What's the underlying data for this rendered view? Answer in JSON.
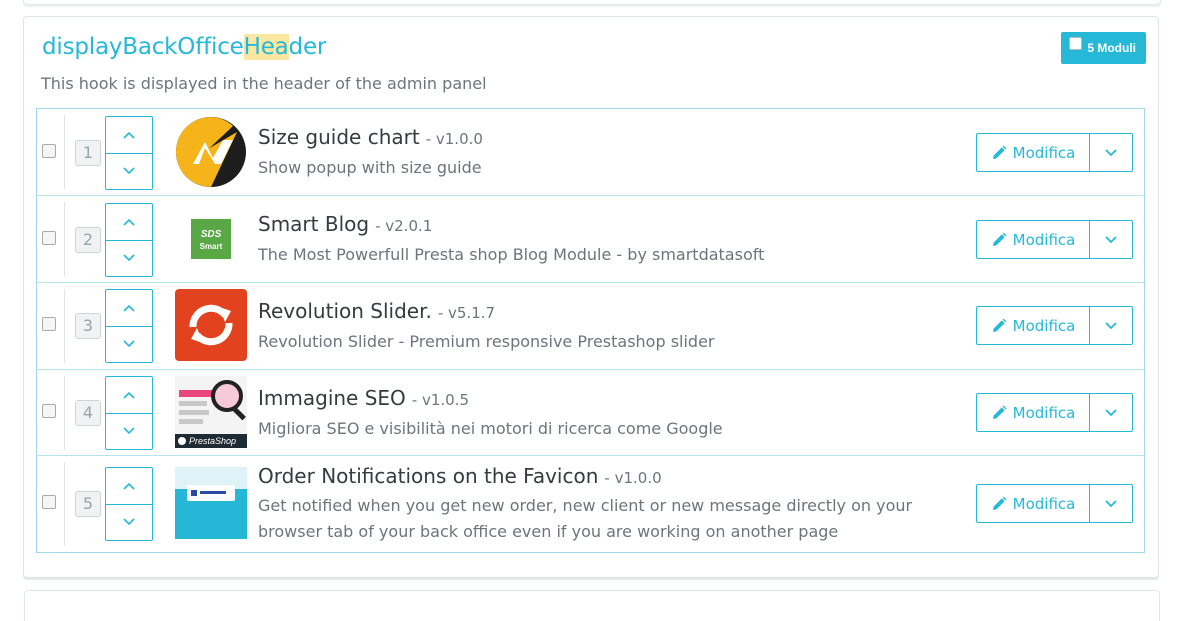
{
  "hook": {
    "title_before": "displayBackOffice",
    "title_highlight": "Hea",
    "title_after": "der",
    "description": "This hook is displayed in the header of the admin panel",
    "badge_label": "5 Moduli"
  },
  "edit_label": "Modifica",
  "modules": [
    {
      "position": "1",
      "name": "Size guide chart",
      "version": "- v1.0.0",
      "description": "Show popup with size guide",
      "logo": "size-guide-logo"
    },
    {
      "position": "2",
      "name": "Smart Blog",
      "version": "- v2.0.1",
      "description": "The Most Powerfull Presta shop Blog Module - by smartdatasoft",
      "logo": "smart-blog-logo",
      "logo_text_top": "SDS",
      "logo_text_bottom": "Smart"
    },
    {
      "position": "3",
      "name": "Revolution Slider.",
      "version": "- v5.1.7",
      "description": "Revolution Slider - Premium responsive Prestashop slider",
      "logo": "revolution-slider-logo"
    },
    {
      "position": "4",
      "name": "Immagine SEO",
      "version": "- v1.0.5",
      "description": "Migliora SEO e visibilità nei motori di ricerca come Google",
      "logo": "seo-image-logo",
      "logo_text": "PrestaShop"
    },
    {
      "position": "5",
      "name": "Order Notifications on the Favicon",
      "version": "- v1.0.0",
      "description": "Get notified when you get new order, new client or new message directly on your browser tab of your back office even if you are working on another page",
      "logo": "favicon-notification-logo"
    }
  ],
  "colors": {
    "accent": "#25b9d7",
    "highlight": "#fbe6a2",
    "title_text": "#363a41",
    "muted_text": "#6c757d"
  }
}
